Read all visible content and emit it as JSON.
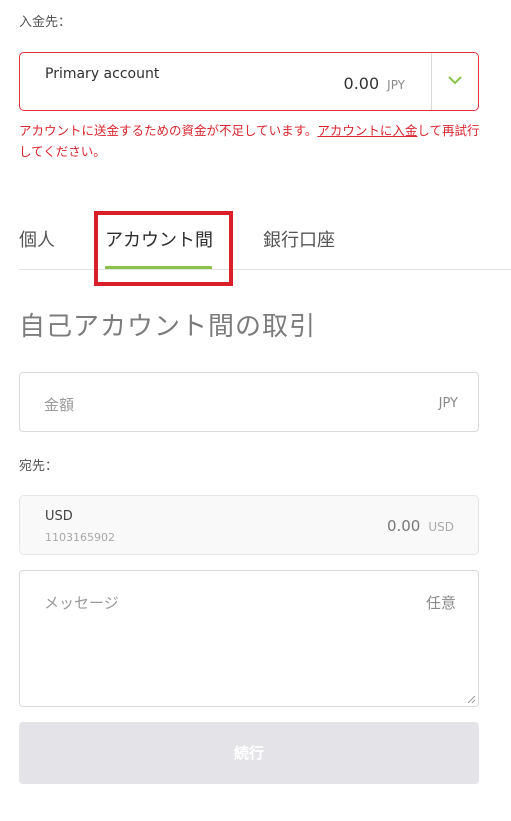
{
  "deposit_to": {
    "label": "入金先：",
    "account_name": "Primary account",
    "balance": "0.00",
    "currency": "JPY"
  },
  "error": {
    "text_before": "アカウントに送金するための資金が不足しています。",
    "link": "アカウントに入金",
    "text_after": "して再試行してください。"
  },
  "tabs": [
    {
      "label": "個人",
      "active": false
    },
    {
      "label": "アカウント間",
      "active": true
    },
    {
      "label": "銀行口座",
      "active": false
    }
  ],
  "section_title": "自己アカウント間の取引",
  "amount": {
    "placeholder": "金額",
    "currency": "JPY"
  },
  "destination": {
    "label": "宛先：",
    "account_name": "USD",
    "account_number": "1103165902",
    "balance": "0.00",
    "currency": "USD"
  },
  "message": {
    "placeholder": "メッセージ",
    "optional": "任意"
  },
  "submit_label": "続行",
  "colors": {
    "error": "#d9262f",
    "accent": "#8bc34a",
    "highlight": "#d9202a"
  }
}
